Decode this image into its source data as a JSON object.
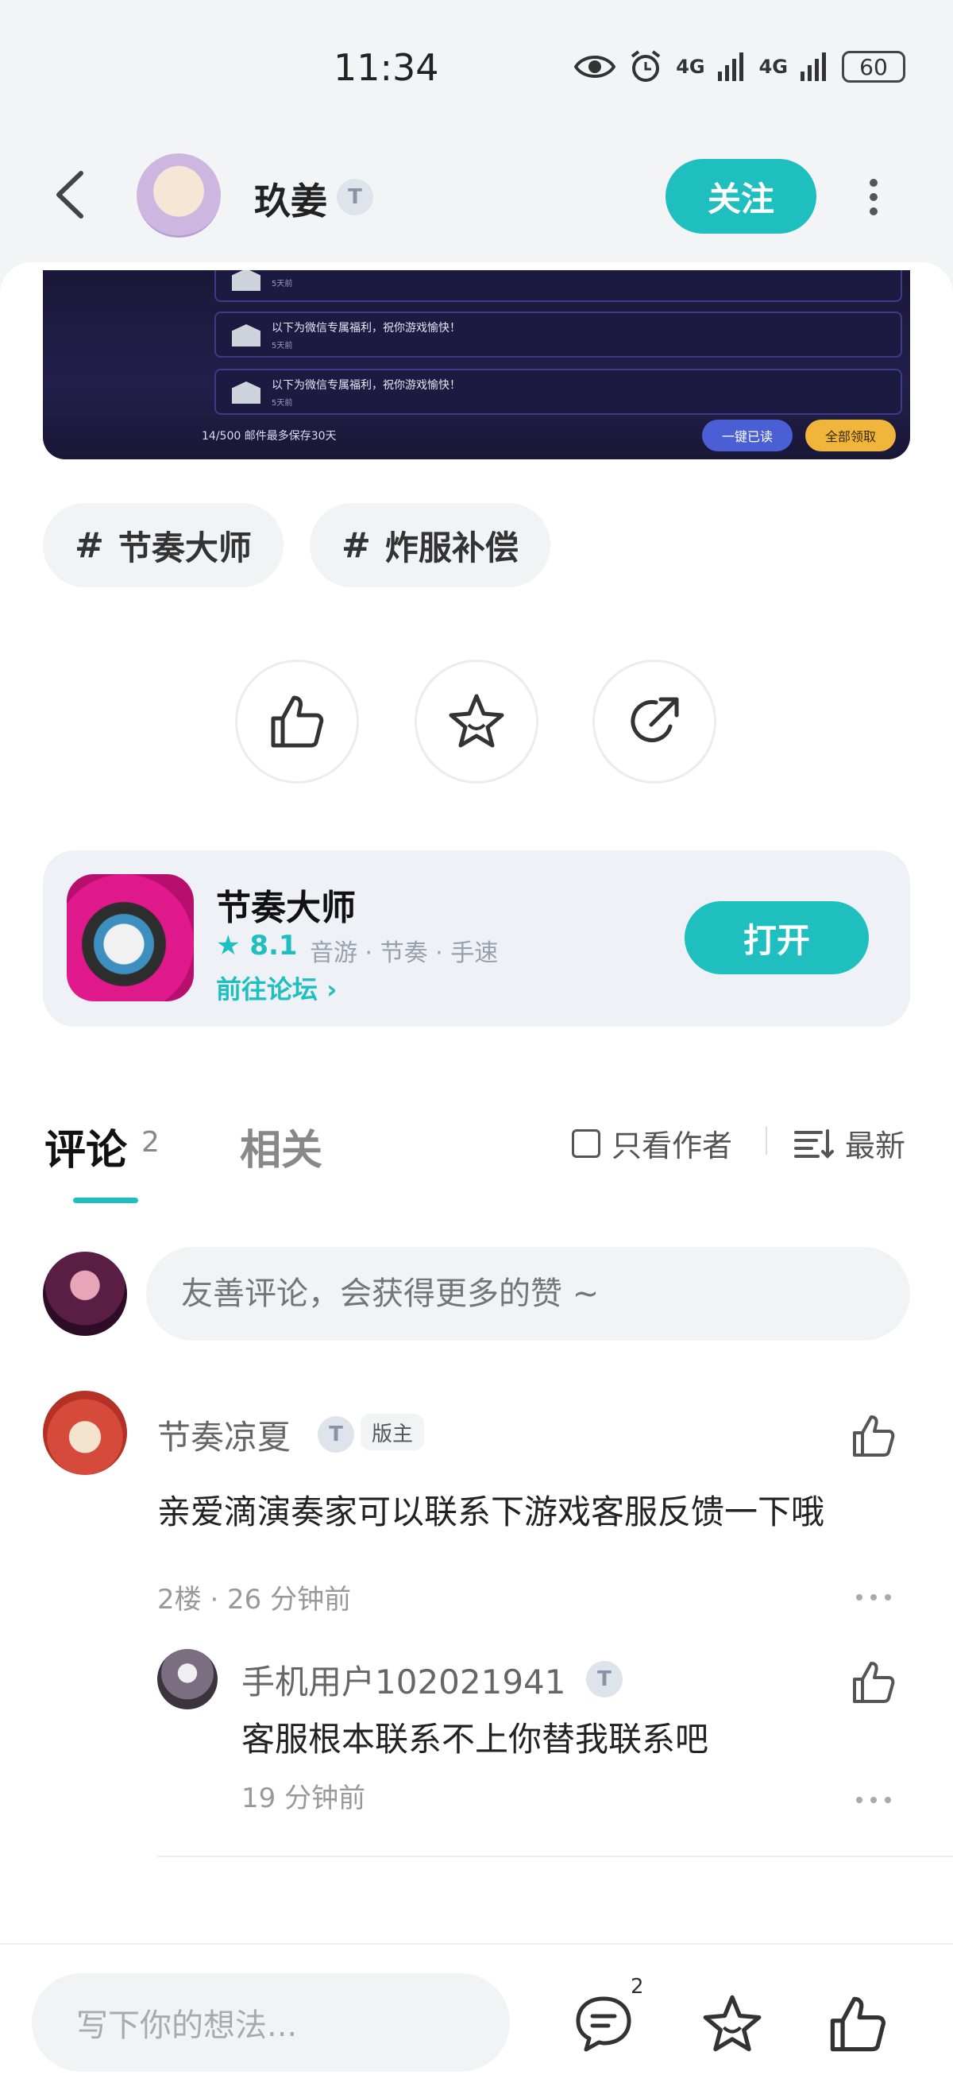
{
  "status": {
    "time": "11:34",
    "battery": "60",
    "net1": "4G",
    "net2": "4G"
  },
  "header": {
    "author": "玖姜",
    "level": "T",
    "follow_label": "关注"
  },
  "post_image": {
    "rows": [
      {
        "title": "",
        "sub": "5天前"
      },
      {
        "title": "以下为微信专属福利，祝你游戏愉快！",
        "sub": "5天前"
      },
      {
        "title": "以下为微信专属福利，祝你游戏愉快！",
        "sub": "5天前"
      }
    ],
    "footer": "14/500 邮件最多保存30天",
    "btn_read": "一键已读",
    "btn_claim": "全部领取"
  },
  "tags": [
    {
      "label": "节奏大师"
    },
    {
      "label": "炸服补偿"
    }
  ],
  "actions": [
    {
      "icon": "thumbs-up-icon"
    },
    {
      "icon": "star-icon"
    },
    {
      "icon": "share-icon"
    }
  ],
  "game": {
    "title": "节奏大师",
    "rating": "8.1",
    "tags": "音游 · 节奏 · 手速",
    "forum_link": "前往论坛",
    "open_label": "打开"
  },
  "comments_section": {
    "tab_comment": "评论",
    "comment_count": "2",
    "tab_related": "相关",
    "author_only": "只看作者",
    "sort_label": "最新",
    "input_placeholder": "友善评论，会获得更多的赞 ~",
    "items": [
      {
        "name": "节奏凉夏",
        "badge": "版主",
        "text": "亲爱滴演奏家可以联系下游戏客服反馈一下哦",
        "meta": "2楼 · 26 分钟前",
        "replies": [
          {
            "name": "手机用户102021941",
            "text": "客服根本联系不上你替我联系吧",
            "meta": "19 分钟前"
          }
        ]
      }
    ]
  },
  "bottom": {
    "write_placeholder": "写下你的想法...",
    "comment_count": "2"
  },
  "colors": {
    "accent": "#1fbfbf"
  }
}
